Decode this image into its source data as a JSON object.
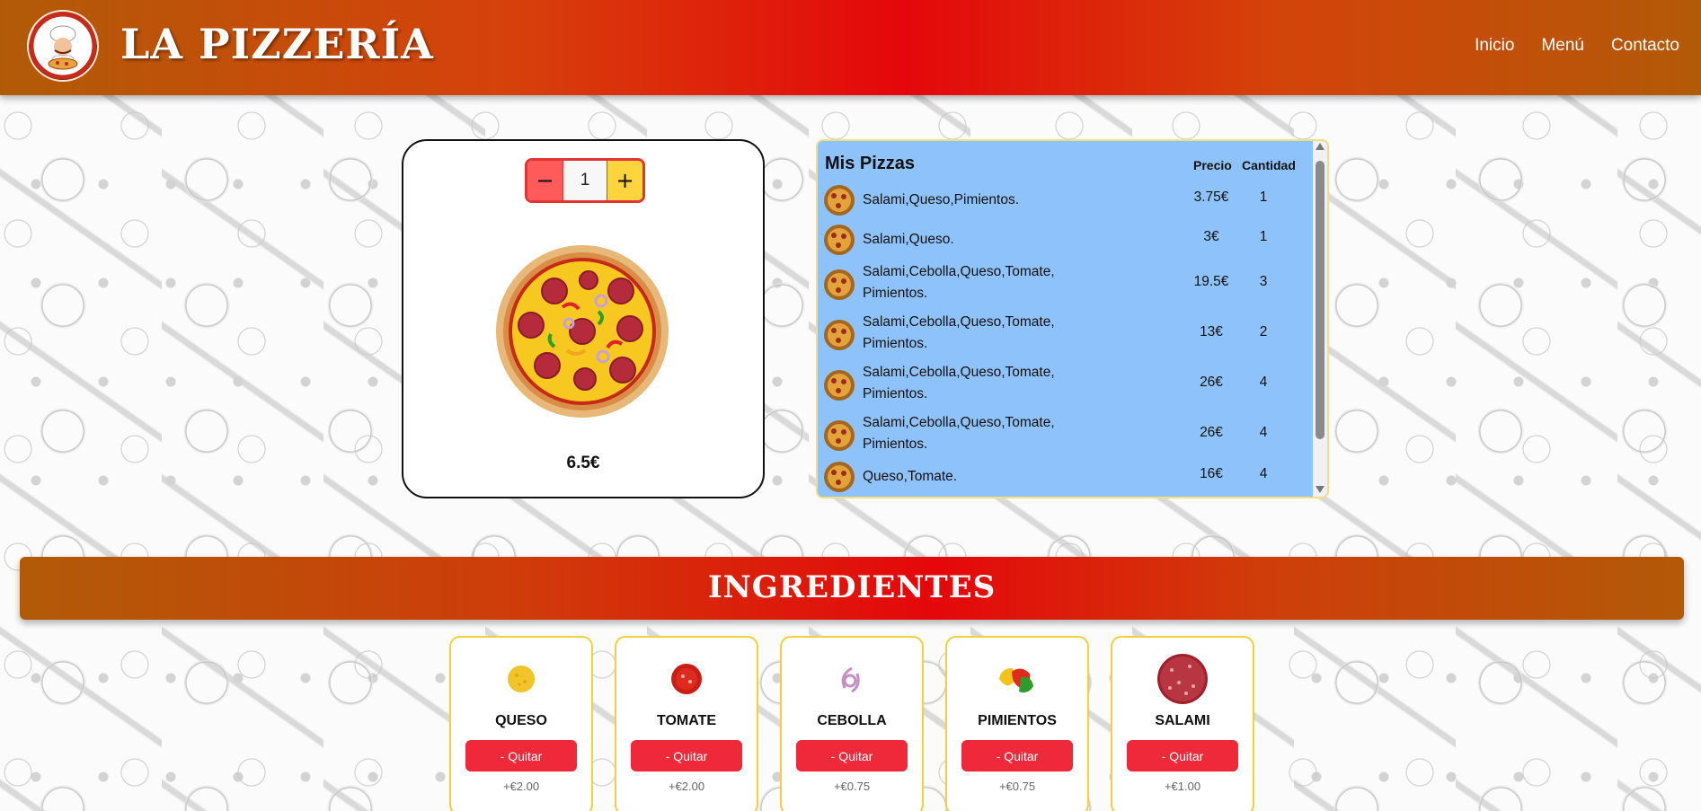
{
  "header": {
    "brand": "LA PIZZERÍA",
    "nav": [
      "Inicio",
      "Menú",
      "Contacto"
    ]
  },
  "builder": {
    "minus": "−",
    "quantity": "1",
    "plus": "+",
    "price": "6.5€"
  },
  "mis_pizzas": {
    "title": "Mis Pizzas",
    "col_precio": "Precio",
    "col_cantidad": "Cantidad",
    "rows": [
      {
        "desc": "Salami,Queso,Pimientos.",
        "precio": "3.75€",
        "cantidad": "1"
      },
      {
        "desc": "Salami,Queso.",
        "precio": "3€",
        "cantidad": "1"
      },
      {
        "desc": "Salami,Cebolla,Queso,Tomate, Pimientos.",
        "precio": "19.5€",
        "cantidad": "3"
      },
      {
        "desc": "Salami,Cebolla,Queso,Tomate, Pimientos.",
        "precio": "13€",
        "cantidad": "2"
      },
      {
        "desc": "Salami,Cebolla,Queso,Tomate, Pimientos.",
        "precio": "26€",
        "cantidad": "4"
      },
      {
        "desc": "Salami,Cebolla,Queso,Tomate, Pimientos.",
        "precio": "26€",
        "cantidad": "4"
      },
      {
        "desc": "Queso,Tomate.",
        "precio": "16€",
        "cantidad": "4"
      }
    ]
  },
  "ingredientes": {
    "title": "INGREDIENTES",
    "items": [
      {
        "name": "QUESO",
        "button": "- Quitar",
        "price": "+€2.00"
      },
      {
        "name": "TOMATE",
        "button": "- Quitar",
        "price": "+€2.00"
      },
      {
        "name": "CEBOLLA",
        "button": "- Quitar",
        "price": "+€0.75"
      },
      {
        "name": "PIMIENTOS",
        "button": "- Quitar",
        "price": "+€0.75"
      },
      {
        "name": "SALAMI",
        "button": "- Quitar",
        "price": "+€1.00"
      }
    ]
  },
  "colors": {
    "header_red": "#e5070b",
    "header_orange": "#b15b08",
    "panel_blue": "#8ec2fb",
    "button_red": "#f0293a",
    "plus_yellow": "#ffd43d"
  }
}
